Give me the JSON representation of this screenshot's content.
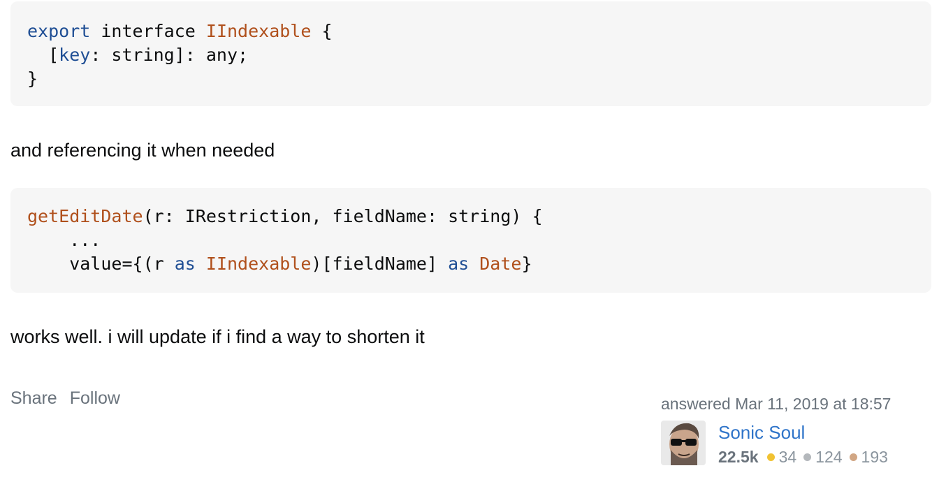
{
  "code1": {
    "l1": {
      "kw": "export",
      "mid": " interface ",
      "ty": "IIndexable",
      "end": " {"
    },
    "l2": {
      "pre": "  [",
      "kw": "key",
      "end": ": string]: any;"
    },
    "l3": "}"
  },
  "prose1": "and referencing it when needed",
  "code2": {
    "l1": {
      "fn": "getEditDate",
      "end": "(r: IRestriction, fieldName: string) {"
    },
    "l2": "    ...",
    "l3": {
      "pre": "    value={(r ",
      "kw1": "as",
      "sp": " ",
      "ty1": "IIndexable",
      "mid": ")[fieldName] ",
      "kw2": "as",
      "sp2": " ",
      "ty2": "Date",
      "end": "}"
    }
  },
  "prose2": "works well. i will update if i find a way to shorten it",
  "menu": {
    "share": "Share",
    "follow": "Follow"
  },
  "user": {
    "action_time": "answered Mar 11, 2019 at 18:57",
    "name": "Sonic Soul",
    "reputation": "22.5k",
    "gold": "34",
    "silver": "124",
    "bronze": "193",
    "gold_color": "#f1c232",
    "silver_color": "#b4b8bc",
    "bronze_color": "#d1a684"
  }
}
